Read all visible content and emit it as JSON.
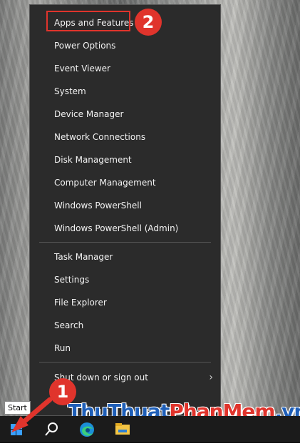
{
  "menu": {
    "group1": [
      {
        "label": "Apps and Features"
      },
      {
        "label": "Power Options"
      },
      {
        "label": "Event Viewer"
      },
      {
        "label": "System"
      },
      {
        "label": "Device Manager"
      },
      {
        "label": "Network Connections"
      },
      {
        "label": "Disk Management"
      },
      {
        "label": "Computer Management"
      },
      {
        "label": "Windows PowerShell"
      },
      {
        "label": "Windows PowerShell (Admin)"
      }
    ],
    "group2": [
      {
        "label": "Task Manager"
      },
      {
        "label": "Settings"
      },
      {
        "label": "File Explorer"
      },
      {
        "label": "Search"
      },
      {
        "label": "Run"
      }
    ],
    "group3": [
      {
        "label": "Shut down or sign out",
        "submenu_icon": "chevron-right-icon"
      },
      {
        "label": "Desktop",
        "visible_text": "top"
      }
    ]
  },
  "annotations": {
    "step1": "1",
    "step2": "2",
    "accent_color": "#e0342c"
  },
  "tooltip": {
    "text": "Start"
  },
  "watermark": {
    "part1": "Thu",
    "part2": "Thuat",
    "part3": "Phan",
    "part4": "Mem",
    "part5": ".vn",
    "color_blue": "#1f5fb8",
    "color_red": "#e0342c"
  },
  "taskbar": {
    "icons": [
      "windows-start-icon",
      "search-icon",
      "edge-icon",
      "file-explorer-icon"
    ]
  }
}
